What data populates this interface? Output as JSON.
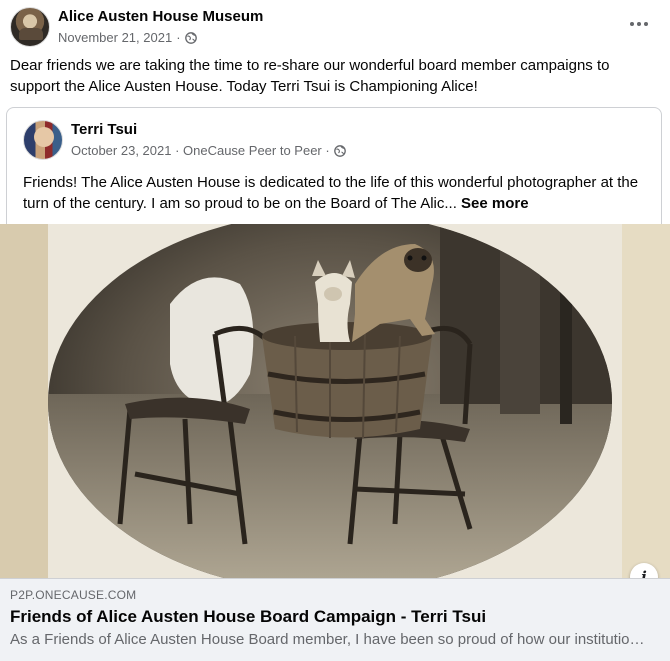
{
  "post": {
    "author": "Alice Austen House Museum",
    "date": "November 21, 2021",
    "separator": "·",
    "privacy_icon": "globe-icon",
    "more_icon": "more-options-icon",
    "text": "Dear friends we are taking the time to re-share our wonderful board member campaigns to support the Alice Austen House. Today Terri Tsui is Championing Alice!"
  },
  "shared": {
    "author": "Terri Tsui",
    "date": "October 23, 2021 · OneCause Peer to Peer ·",
    "privacy_icon": "globe-icon",
    "text": "Friends! The Alice Austen House is dedicated to the life of this wonderful photographer at the turn of the century. I am so proud to be on the Board of The Alic...",
    "see_more": "See more"
  },
  "link_preview": {
    "domain": "P2P.ONECAUSE.COM",
    "title": "Friends of Alice Austen House Board Campaign - Terri Tsui",
    "description": "As a Friends of Alice Austen House Board member, I have been so proud of how our institution has grown",
    "info_label": "i"
  },
  "colors": {
    "text_primary": "#050505",
    "text_secondary": "#65676b",
    "preview_bg": "#f0f2f5",
    "border": "#ced0d4"
  }
}
